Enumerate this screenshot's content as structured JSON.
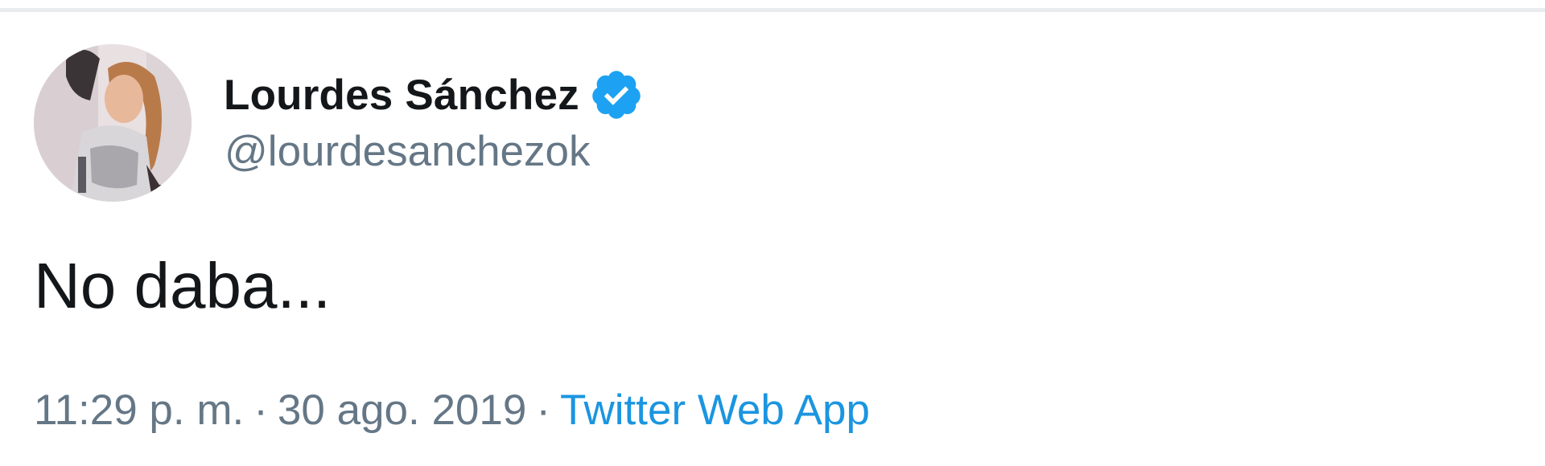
{
  "tweet": {
    "author": {
      "display_name": "Lourdes Sánchez",
      "handle": "@lourdesanchezok",
      "verified": true,
      "avatar_icon": "profile-photo"
    },
    "text": "No daba...",
    "meta": {
      "time": "11:29 p. m.",
      "separator": "·",
      "date": "30 ago. 2019",
      "source": "Twitter Web App"
    }
  },
  "colors": {
    "name": "#14171a",
    "secondary": "#657786",
    "link": "#1b95e0",
    "verified_badge": "#1da1f2",
    "divider": "#e8ecef"
  }
}
